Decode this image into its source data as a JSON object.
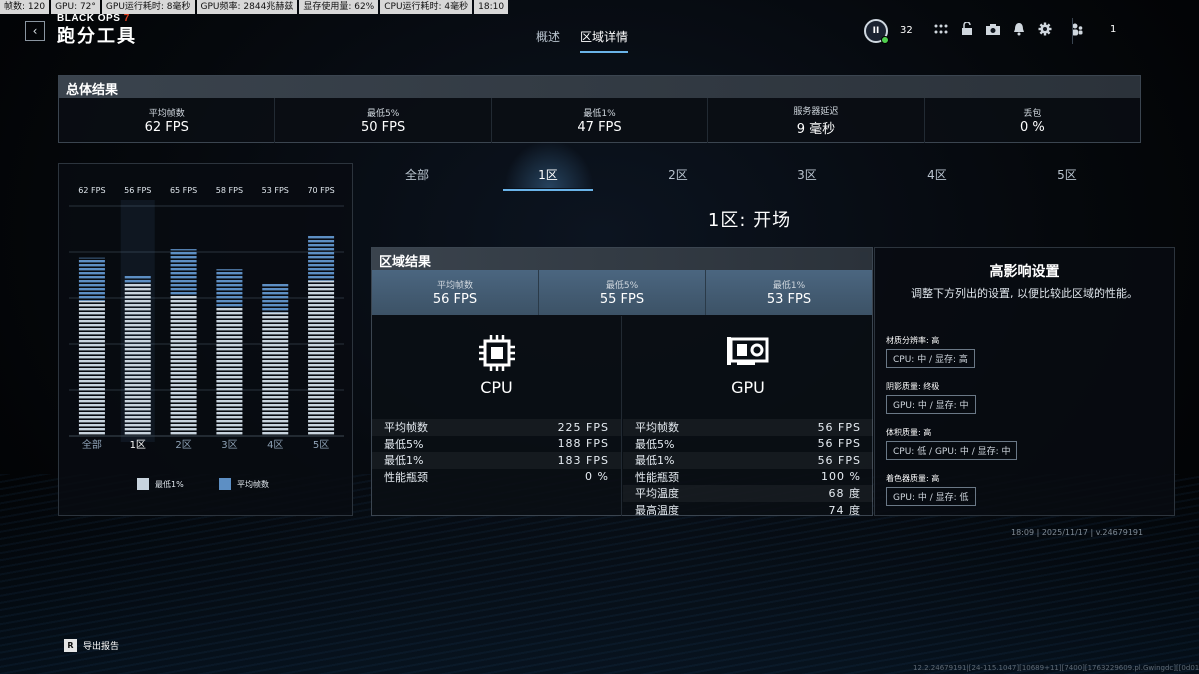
{
  "osd": [
    "帧数: 120",
    "GPU: 72°",
    "GPU运行耗时: 8毫秒",
    "GPU频率: 2844兆赫兹",
    "显存使用量: 62%",
    "CPU运行耗时: 4毫秒",
    "18:10"
  ],
  "header": {
    "logo_text": "BLACK OPS",
    "logo_num": "7",
    "title": "跑分工具",
    "tabs": [
      {
        "label": "概述"
      },
      {
        "label": "区域详情"
      }
    ],
    "active_tab": 1,
    "player_level": "32",
    "friends_count": "1"
  },
  "overall": {
    "title": "总体结果",
    "stats": [
      {
        "label": "平均帧数",
        "value": "62 FPS"
      },
      {
        "label": "最低5%",
        "value": "50 FPS"
      },
      {
        "label": "最低1%",
        "value": "47 FPS"
      },
      {
        "label": "服务器延迟",
        "value": "9 毫秒"
      },
      {
        "label": "丢包",
        "value": "0 %"
      }
    ]
  },
  "chart_data": {
    "type": "bar",
    "categories": [
      "全部",
      "1区",
      "2区",
      "3区",
      "4区",
      "5区"
    ],
    "top_labels": [
      "62 FPS",
      "56 FPS",
      "65 FPS",
      "58 FPS",
      "53 FPS",
      "70 FPS"
    ],
    "series": [
      {
        "name": "最低1%",
        "values": [
          47,
          53,
          49,
          45,
          43,
          54
        ]
      },
      {
        "name": "平均帧数",
        "values": [
          62,
          56,
          65,
          58,
          53,
          70
        ]
      }
    ],
    "ylim": [
      0,
      80
    ],
    "selected_index": 1,
    "colors": {
      "low1": "#c8d4de",
      "avg": "#5d8fc4"
    }
  },
  "zones": {
    "tabs": [
      "全部",
      "1区",
      "2区",
      "3区",
      "4区",
      "5区"
    ],
    "active": 1,
    "title": "1区:  开场"
  },
  "zone_result": {
    "title": "区域结果",
    "stats": [
      {
        "label": "平均帧数",
        "value": "56 FPS"
      },
      {
        "label": "最低5%",
        "value": "55 FPS"
      },
      {
        "label": "最低1%",
        "value": "53 FPS"
      }
    ],
    "cpu": {
      "name": "CPU",
      "rows": [
        {
          "label": "平均帧数",
          "value": "225 FPS"
        },
        {
          "label": "最低5%",
          "value": "188 FPS"
        },
        {
          "label": "最低1%",
          "value": "183 FPS"
        },
        {
          "label": "性能瓶颈",
          "value": "0 %"
        }
      ]
    },
    "gpu": {
      "name": "GPU",
      "rows": [
        {
          "label": "平均帧数",
          "value": "56 FPS"
        },
        {
          "label": "最低5%",
          "value": "56 FPS"
        },
        {
          "label": "最低1%",
          "value": "56 FPS"
        },
        {
          "label": "性能瓶颈",
          "value": "100 %"
        },
        {
          "label": "平均温度",
          "value": "68 度"
        },
        {
          "label": "最高温度",
          "value": "74 度"
        }
      ]
    }
  },
  "settings": {
    "title": "高影响设置",
    "desc": "调整下方列出的设置, 以便比较此区域的性能。",
    "items": [
      {
        "label": "材质分辨率: 高",
        "value": "CPU: 中 / 显存: 高"
      },
      {
        "label": "阴影质量: 终极",
        "value": "GPU: 中 / 显存: 中"
      },
      {
        "label": "体积质量: 高",
        "value": "CPU: 低 / GPU: 中 / 显存: 中"
      },
      {
        "label": "着色器质量: 高",
        "value": "GPU: 中 / 显存: 低"
      }
    ]
  },
  "footer": {
    "version": "18:09 | 2025/11/17 | v.24679191",
    "export_key": "R",
    "export_label": "导出报告",
    "build": "12.2.24679191|[24-115.1047][10689+11][7400][1763229609.pl.Gwingdc][[0d0122]]]]]"
  }
}
